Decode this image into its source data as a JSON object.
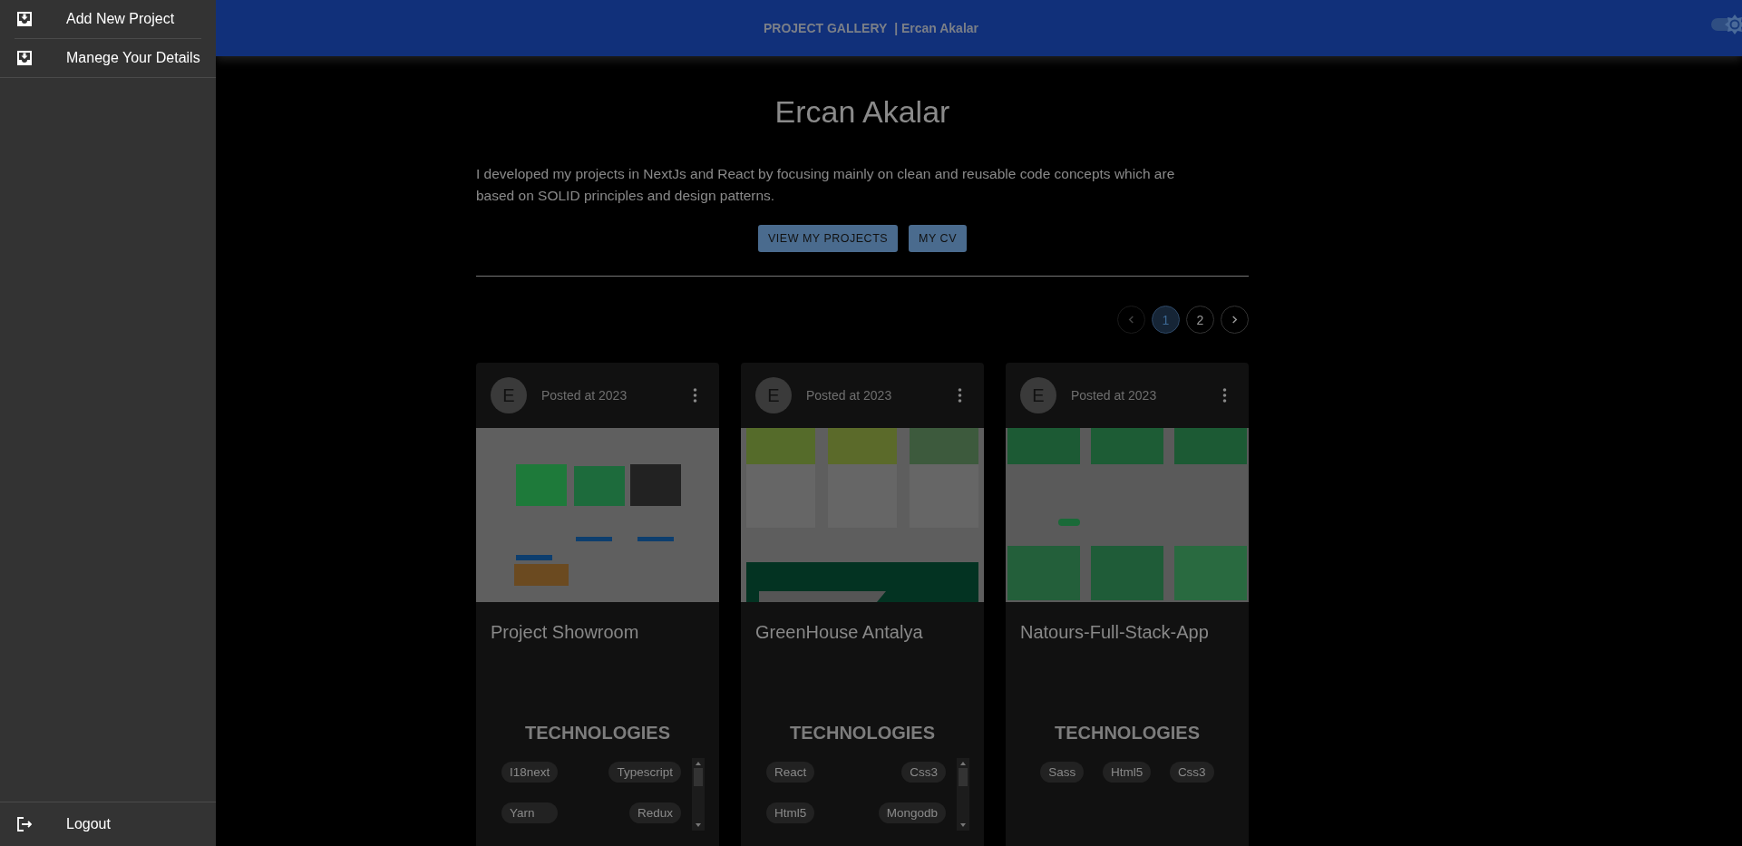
{
  "drawer": {
    "items": [
      {
        "label": "Add New Project"
      },
      {
        "label": "Manege Your Details"
      }
    ],
    "footer": {
      "label": "Logout"
    }
  },
  "header": {
    "title": "PROJECT GALLERY",
    "subtitle": "| Ercan Akalar",
    "theme_toggle": {
      "on": true
    }
  },
  "profile": {
    "name": "Ercan Akalar",
    "bio": "I developed my projects in NextJs and React by focusing mainly on clean and reusable code concepts which are based on SOLID principles and design patterns.",
    "buttons": [
      "VIEW MY PROJECTS",
      "MY CV"
    ]
  },
  "pagination": {
    "prev": {
      "disabled": true
    },
    "pages": [
      {
        "label": "1",
        "selected": true
      },
      {
        "label": "2",
        "selected": false
      }
    ],
    "next": {
      "disabled": false
    }
  },
  "cards": [
    {
      "avatar": "E",
      "posted": "Posted at 2023",
      "title": "Project Showroom",
      "tech_heading": "TECHNOLOGIES",
      "scrollable": true,
      "chips": [
        "I18next",
        "Typescript",
        "Yarn",
        "Redux"
      ]
    },
    {
      "avatar": "E",
      "posted": "Posted at 2023",
      "title": "GreenHouse Antalya",
      "tech_heading": "TECHNOLOGIES",
      "scrollable": true,
      "chips": [
        "React",
        "Css3",
        "Html5",
        "Mongodb"
      ]
    },
    {
      "avatar": "E",
      "posted": "Posted at 2023",
      "title": "Natours-Full-Stack-App",
      "tech_heading": "TECHNOLOGIES",
      "scrollable": false,
      "chips": [
        "Sass",
        "Html5",
        "Css3"
      ]
    }
  ]
}
